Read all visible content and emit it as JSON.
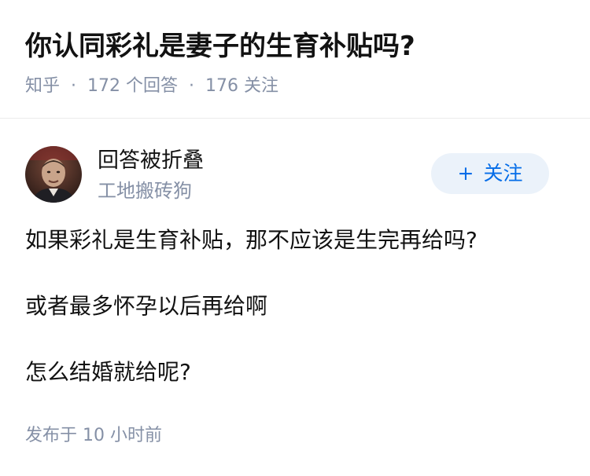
{
  "question": {
    "title": "你认同彩礼是妻子的生育补贴吗?",
    "source": "知乎",
    "answers_count": "172",
    "answers_label": "个回答",
    "followers_count": "176",
    "followers_label": "关注"
  },
  "answer": {
    "author_name": "回答被折叠",
    "author_headline": "工地搬砖狗",
    "follow_button_label": "关注",
    "follow_button_icon": "plus-icon",
    "paragraphs": [
      "如果彩礼是生育补贴，那不应该是生完再给吗?",
      "或者最多怀孕以后再给啊",
      "怎么结婚就给呢?"
    ],
    "published_label": "发布于",
    "published_time": "10 小时前"
  },
  "colors": {
    "title": "#121212",
    "meta": "#8590a6",
    "accent": "#056de8",
    "follow_bg": "#ebf2fa",
    "divider": "#ebebeb"
  }
}
